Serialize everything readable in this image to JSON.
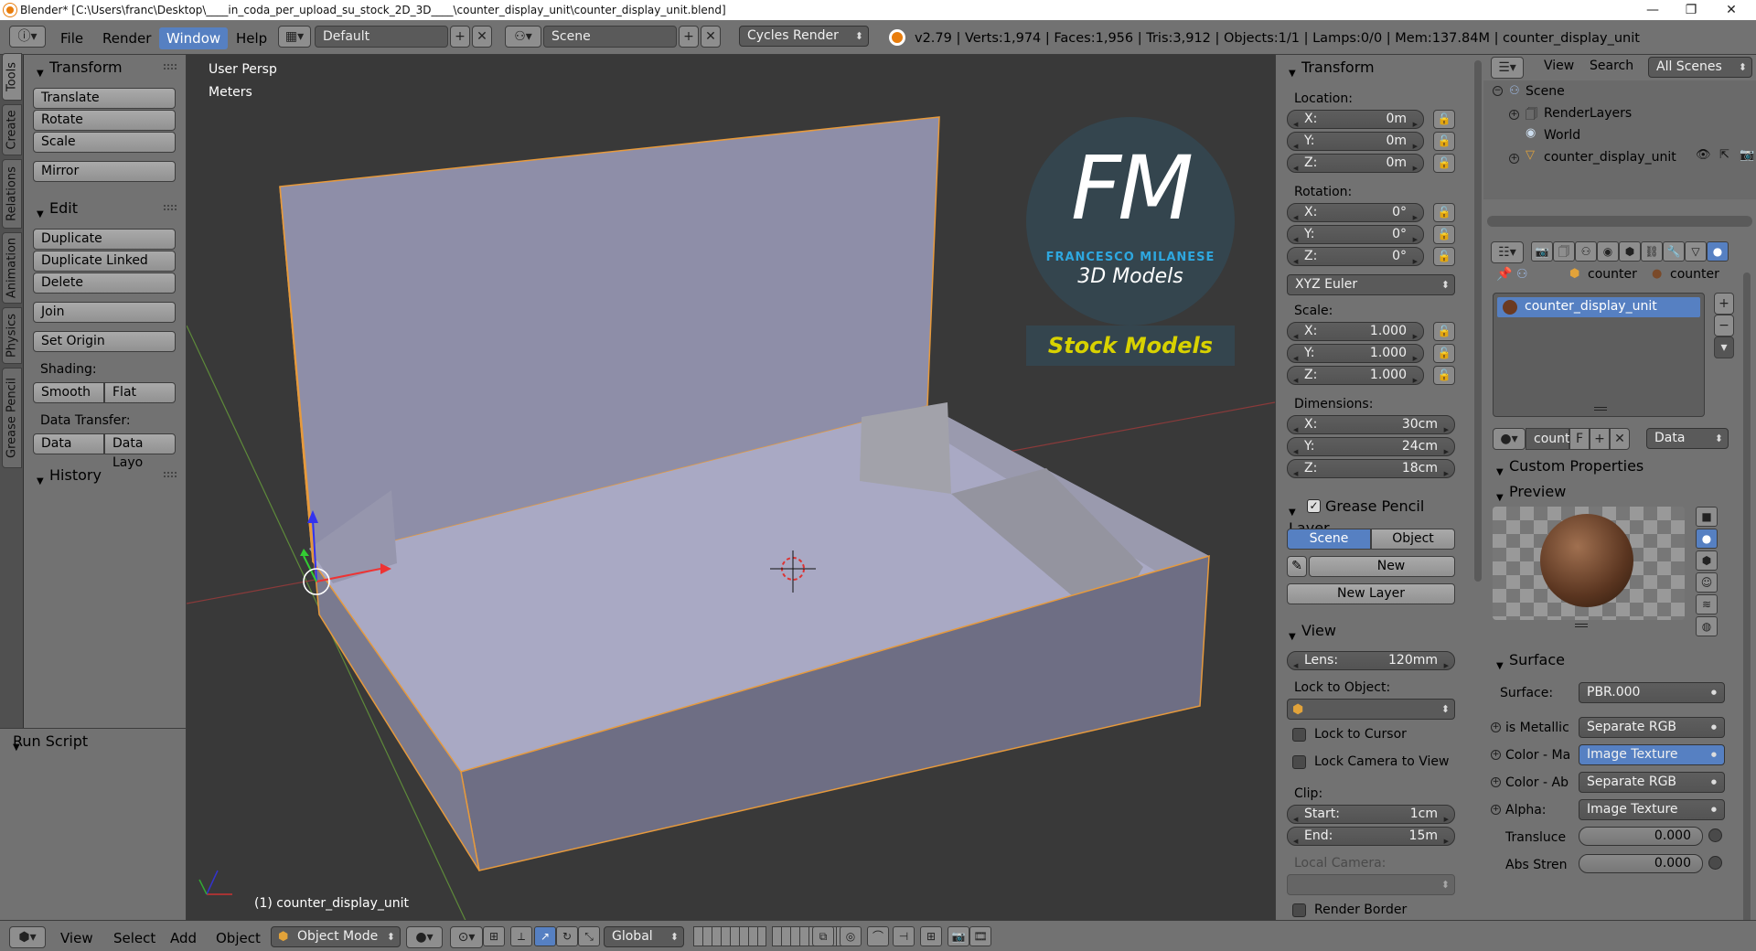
{
  "window": {
    "title": "Blender* [C:\\Users\\franc\\Desktop\\____in_coda_per_upload_su_stock_2D_3D____\\counter_display_unit\\counter_display_unit.blend]",
    "controls": [
      "—",
      "❐",
      "✕"
    ]
  },
  "infobar": {
    "menus": [
      "File",
      "Render",
      "Window",
      "Help"
    ],
    "active_menu": "Window",
    "layout": "Default",
    "scene": "Scene",
    "engine": "Cycles Render",
    "stats": "v2.79 | Verts:1,974 | Faces:1,956 | Tris:3,912 | Objects:1/1 | Lamps:0/0 | Mem:137.84M | counter_display_unit"
  },
  "left_tabs": [
    "Tools",
    "Create",
    "Relations",
    "Animation",
    "Physics",
    "Grease Pencil"
  ],
  "toolshelf": {
    "transform_header": "Transform",
    "transform_buttons": [
      "Translate",
      "Rotate",
      "Scale"
    ],
    "mirror": "Mirror",
    "edit_header": "Edit",
    "edit_buttons": [
      "Duplicate",
      "Duplicate Linked",
      "Delete"
    ],
    "join": "Join",
    "set_origin": "Set Origin",
    "shading_label": "Shading:",
    "smooth": "Smooth",
    "flat": "Flat",
    "data_transfer_label": "Data Transfer:",
    "data": "Data",
    "data_layo": "Data Layo",
    "history_header": "History",
    "run_script_header": "Run Script"
  },
  "viewport": {
    "view_name": "User Persp",
    "units": "Meters",
    "object_label": "(1) counter_display_unit",
    "logo_letters": "FM",
    "logo_name": "FRANCESCO MILANESE",
    "logo_sub": "3D Models",
    "logo_stock": "Stock Models"
  },
  "npanel": {
    "transform_header": "Transform",
    "location_label": "Location:",
    "location": [
      {
        "axis": "X:",
        "value": "0m"
      },
      {
        "axis": "Y:",
        "value": "0m"
      },
      {
        "axis": "Z:",
        "value": "0m"
      }
    ],
    "rotation_label": "Rotation:",
    "rotation": [
      {
        "axis": "X:",
        "value": "0°"
      },
      {
        "axis": "Y:",
        "value": "0°"
      },
      {
        "axis": "Z:",
        "value": "0°"
      }
    ],
    "rotation_mode": "XYZ Euler",
    "scale_label": "Scale:",
    "scale": [
      {
        "axis": "X:",
        "value": "1.000"
      },
      {
        "axis": "Y:",
        "value": "1.000"
      },
      {
        "axis": "Z:",
        "value": "1.000"
      }
    ],
    "dimensions_label": "Dimensions:",
    "dimensions": [
      {
        "axis": "X:",
        "value": "30cm"
      },
      {
        "axis": "Y:",
        "value": "24cm"
      },
      {
        "axis": "Z:",
        "value": "18cm"
      }
    ],
    "grease_header": "Grease Pencil Layer",
    "gp_scene": "Scene",
    "gp_object": "Object",
    "gp_new": "New",
    "gp_new_layer": "New Layer",
    "view_header": "View",
    "lens_label": "Lens:",
    "lens_value": "120mm",
    "lock_to_object": "Lock to Object:",
    "lock_to_cursor": "Lock to Cursor",
    "lock_camera": "Lock Camera to View",
    "clip_label": "Clip:",
    "clip_start_label": "Start:",
    "clip_start": "1cm",
    "clip_end_label": "End:",
    "clip_end": "15m",
    "local_camera": "Local Camera:",
    "render_border": "Render Border"
  },
  "outliner": {
    "view": "View",
    "search": "Search",
    "filter": "All Scenes",
    "items": [
      "Scene",
      "RenderLayers",
      "World",
      "counter_display_unit"
    ]
  },
  "properties": {
    "breadcrumb": [
      "counter",
      "counter"
    ],
    "material_slot": "counter_display_unit",
    "mat_field": "count",
    "mat_f": "F",
    "data_dropdown": "Data",
    "custom_props": "Custom Properties",
    "preview": "Preview",
    "surface_header": "Surface",
    "surface_label": "Surface:",
    "surface_value": "PBR.000",
    "inputs": [
      {
        "label": "is Metallic",
        "value": "Separate RGB",
        "highlight": false
      },
      {
        "label": "Color - Ma",
        "value": "Image Texture",
        "highlight": true
      },
      {
        "label": "Color - Ab",
        "value": "Separate RGB",
        "highlight": false
      },
      {
        "label": "Alpha:",
        "value": "Image Texture",
        "highlight": false
      }
    ],
    "translucency_label": "Transluce",
    "translucency_value": "0.000",
    "abs_label": "Abs Stren",
    "abs_value": "0.000"
  },
  "bottombar": {
    "menus": [
      "View",
      "Select",
      "Add",
      "Object"
    ],
    "mode": "Object Mode",
    "orientation": "Global"
  }
}
